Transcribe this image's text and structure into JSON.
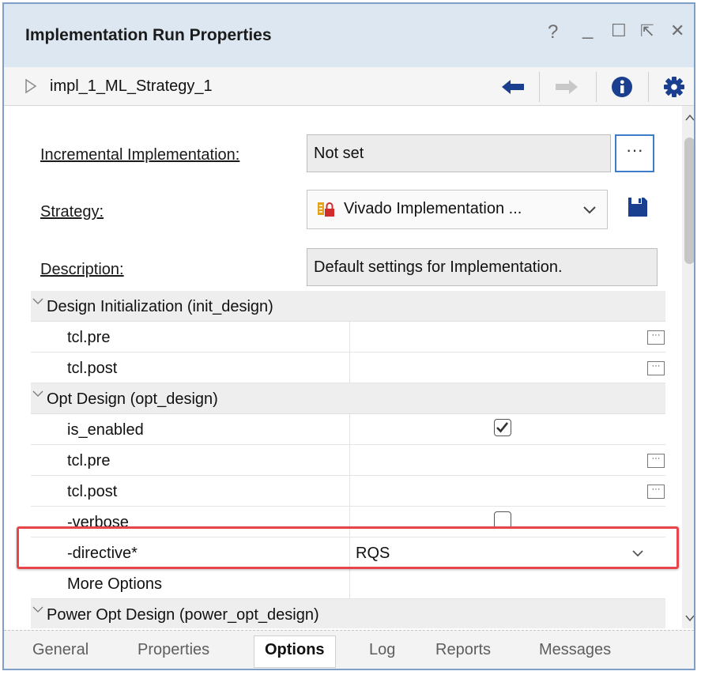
{
  "window": {
    "title": "Implementation Run Properties",
    "controls": [
      "?",
      "_",
      "☐",
      "⇱",
      "✕"
    ]
  },
  "toolbar": {
    "run_name": "impl_1_ML_Strategy_1",
    "icons": [
      "play-icon",
      "back-arrow-icon",
      "forward-arrow-icon",
      "info-icon",
      "gear-icon"
    ]
  },
  "form": {
    "incremental_label": "Incremental Implementation:",
    "incremental_value": "Not set",
    "browse_label": "···",
    "strategy_label": "Strategy:",
    "strategy_value": "Vivado Implementation ...",
    "description_label": "Description:",
    "description_value": "Default settings for Implementation."
  },
  "groups": [
    {
      "title": "Design Initialization (init_design)",
      "rows": [
        {
          "name": "tcl.pre",
          "kind": "file"
        },
        {
          "name": "tcl.post",
          "kind": "file"
        }
      ]
    },
    {
      "title": "Opt Design (opt_design)",
      "rows": [
        {
          "name": "is_enabled",
          "kind": "checkbox",
          "checked": true
        },
        {
          "name": "tcl.pre",
          "kind": "file"
        },
        {
          "name": "tcl.post",
          "kind": "file"
        },
        {
          "name": "-verbose",
          "kind": "checkbox",
          "checked": false
        },
        {
          "name": "-directive*",
          "kind": "dropdown",
          "value": "RQS"
        },
        {
          "name": "More Options",
          "kind": "text"
        }
      ]
    },
    {
      "title": "Power Opt Design (power_opt_design)",
      "rows": []
    }
  ],
  "tabs": [
    {
      "label": "General",
      "active": false
    },
    {
      "label": "Properties",
      "active": false
    },
    {
      "label": "Options",
      "active": true
    },
    {
      "label": "Log",
      "active": false
    },
    {
      "label": "Reports",
      "active": false
    },
    {
      "label": "Messages",
      "active": false
    }
  ],
  "colors": {
    "title_bar": "#dde7f2",
    "highlight_box": "#e8454a",
    "accent_blue": "#1a3f8f",
    "field_background": "#ececec"
  }
}
